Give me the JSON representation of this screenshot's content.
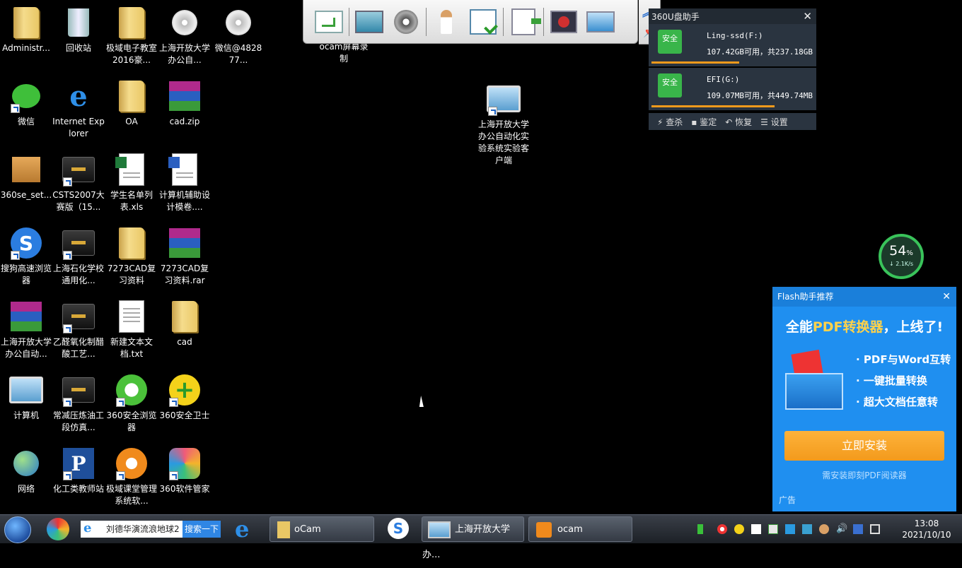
{
  "desktop_icons": [
    {
      "id": "admin",
      "label": "Administr..."
    },
    {
      "id": "recycle",
      "label": "回收站"
    },
    {
      "id": "jiyu-classroom",
      "label": "极域电子教室2016豪..."
    },
    {
      "id": "shou-office",
      "label": "上海开放大学办公自..."
    },
    {
      "id": "wechat-installer",
      "label": "微信@482877..."
    },
    {
      "id": "wechat",
      "label": "微信"
    },
    {
      "id": "ie",
      "label": "Internet Explorer"
    },
    {
      "id": "oa",
      "label": "OA"
    },
    {
      "id": "cad-zip",
      "label": "cad.zip"
    },
    {
      "id": "360se-setup",
      "label": "360se_set..."
    },
    {
      "id": "csts2007",
      "label": "CSTS2007大赛版（15..."
    },
    {
      "id": "students-xls",
      "label": "学生名单列表.xls"
    },
    {
      "id": "cad-exam-doc",
      "label": "计算机辅助设计模卷...."
    },
    {
      "id": "sogou",
      "label": "搜狗高速浏览器"
    },
    {
      "id": "sh-petro",
      "label": "上海石化学校通用化..."
    },
    {
      "id": "7273cad-folder",
      "label": "7273CAD复习资料"
    },
    {
      "id": "7273cad-rar",
      "label": "7273CAD复习资料.rar"
    },
    {
      "id": "shou-office-rar",
      "label": "上海开放大学办公自动..."
    },
    {
      "id": "acetaldehyde",
      "label": "乙醛氧化制醋酸工艺..."
    },
    {
      "id": "new-txt",
      "label": "新建文本文档.txt"
    },
    {
      "id": "cad-folder",
      "label": "cad"
    },
    {
      "id": "computer",
      "label": "计算机"
    },
    {
      "id": "atm-distill",
      "label": "常减压炼油工段仿真..."
    },
    {
      "id": "360-browser",
      "label": "360安全浏览器"
    },
    {
      "id": "360-guard",
      "label": "360安全卫士"
    },
    {
      "id": "network",
      "label": "网络"
    },
    {
      "id": "chem-teacher",
      "label": "化工类教师站"
    },
    {
      "id": "jiyu-mgmt",
      "label": "极域课堂管理系统软..."
    },
    {
      "id": "360-soft",
      "label": "360软件管家"
    }
  ],
  "ocam_label": "ocam屏幕录制",
  "client_icon_label": "上海开放大学办公自动化实验系统实验客户端",
  "usb_panel": {
    "title": "360U盘助手",
    "drives": [
      {
        "safe": "安全",
        "name": "Ling-ssd(F:)",
        "info": "107.42GB可用，共237.18GB",
        "used": 0.55
      },
      {
        "safe": "安全",
        "name": "EFI(G:)",
        "info": "109.07MB可用，共449.74MB",
        "used": 0.76
      }
    ],
    "actions": [
      "查杀",
      "鉴定",
      "恢复",
      "设置"
    ]
  },
  "speed_ball": {
    "percent": "54",
    "unit": "%",
    "speed": "2.1K/s"
  },
  "flash_ad": {
    "title": "Flash助手推荐",
    "headline_pre": "全能",
    "headline_hl": "PDF转换器",
    "headline_post": "，上线了!",
    "features": [
      "· PDF与Word互转",
      "· 一键批量转换",
      "· 超大文档任意转"
    ],
    "install": "立即安装",
    "note": "需安装即刻PDF阅读器",
    "ad_tag": "广告"
  },
  "taskbar": {
    "search_text": "刘德华演流浪地球2",
    "search_button": "搜索一下",
    "tasks": [
      {
        "label": "oCam"
      },
      {
        "label": "上海开放大学办..."
      },
      {
        "label": "ocam"
      }
    ],
    "time": "13:08",
    "date": "2021/10/10"
  },
  "colors": {
    "accent": "#1f8ff0",
    "install": "#f39a1c",
    "safe": "#39b54a"
  }
}
